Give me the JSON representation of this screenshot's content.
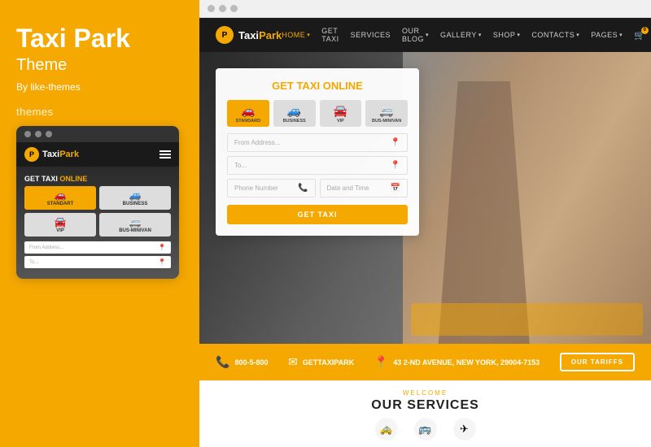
{
  "leftPanel": {
    "title": "Taxi Park",
    "subtitle": "Theme",
    "author": "By like-themes",
    "themesLabel": "themes"
  },
  "mobilePreview": {
    "windowDots": [
      "dot1",
      "dot2",
      "dot3"
    ],
    "logoP": "P",
    "logoTextPart1": "Taxi",
    "logoTextPart2": "Park",
    "heroTitle": "GET TAXI",
    "heroTitleHighlight": "ONLINE",
    "carOptions": [
      {
        "label": "STANDART",
        "selected": true
      },
      {
        "label": "BUSINESS",
        "selected": false
      },
      {
        "label": "VIP",
        "selected": false
      },
      {
        "label": "BUS-MINIVAN",
        "selected": false
      }
    ],
    "inputFrom": "From Address...",
    "inputTo": "To..."
  },
  "desktopPreview": {
    "windowDots": [
      "dot1",
      "dot2",
      "dot3"
    ],
    "logoP": "P",
    "logoText": "TaxiPark",
    "navLinks": [
      {
        "label": "HOME",
        "hasArrow": true,
        "active": true
      },
      {
        "label": "GET TAXI",
        "hasArrow": false,
        "active": false
      },
      {
        "label": "SERVICES",
        "hasArrow": false,
        "active": false
      },
      {
        "label": "OUR BLOG",
        "hasArrow": true,
        "active": false
      },
      {
        "label": "GALLERY",
        "hasArrow": true,
        "active": false
      },
      {
        "label": "SHOP",
        "hasArrow": true,
        "active": false
      },
      {
        "label": "CONTACTS",
        "hasArrow": true,
        "active": false
      },
      {
        "label": "PAGES",
        "hasArrow": true,
        "active": false
      }
    ],
    "cartBadge": "0",
    "booking": {
      "title": "GET TAXI",
      "titleHighlight": "ONLINE",
      "carOptions": [
        {
          "label": "STANDARD",
          "selected": true
        },
        {
          "label": "BUSINESS",
          "selected": false
        },
        {
          "label": "VIP",
          "selected": false
        },
        {
          "label": "BUS-MINIVAN",
          "selected": false
        }
      ],
      "inputFrom": "From Address...",
      "inputTo": "To...",
      "inputPhone": "Phone Number",
      "inputDate": "Date and Time",
      "buttonLabel": "GET TAXI"
    },
    "yellowBar": {
      "phone": "800-5-800",
      "email": "GETTAXIPARK",
      "address": "43 2-ND AVENUE, NEW YORK, 29004-7153",
      "buttonLabel": "OUR TARIFFS"
    },
    "services": {
      "welcome": "WELCOME",
      "title": "OUR SERVICES"
    }
  }
}
